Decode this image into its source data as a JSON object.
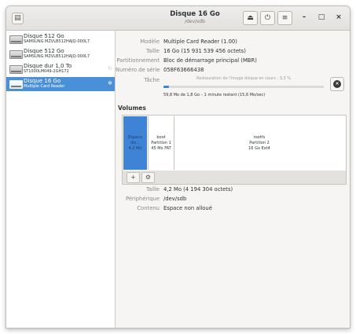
{
  "header": {
    "title": "Disque 16 Go",
    "subtitle": "/dev/sdb",
    "icons": [
      "eject-icon",
      "power-icon",
      "menu-icon",
      "minimize-icon",
      "maximize-icon",
      "close-icon"
    ],
    "left_icon": "sidebar-toggle-icon"
  },
  "sidebar": {
    "items": [
      {
        "name": "Disque 512 Go",
        "model": "SAMSUNG MZVLB512HAJQ-000L7",
        "busy": false
      },
      {
        "name": "Disque 512 Go",
        "model": "SAMSUNG MZVLB512HAJQ-000L7",
        "busy": false
      },
      {
        "name": "Disque dur 1,0 To",
        "model": "ST1000LM049-2GH172",
        "busy": true
      },
      {
        "name": "Disque 16 Go",
        "model": "Multiple Card  Reader",
        "busy": true
      }
    ]
  },
  "details": {
    "model_label": "Modèle",
    "model_value": "Multiple Card  Reader (1.00)",
    "size_label": "Taille",
    "size_value": "16 Go (15 931 539 456 octets)",
    "partitioning_label": "Partitionnement",
    "partitioning_value": "Bloc de démarrage principal (MBR)",
    "serial_label": "Numéro de série",
    "serial_value": "058F63666438",
    "task_label": "Tâche",
    "task_text": "Restauration de l'image disque en cours : 3,3 %",
    "task_progress": 0.033,
    "task_detail": "59,8 Mo de 1,8 Go – 1 minute restant (15,6 Mo/sec)",
    "cancel_icon": "cancel-icon"
  },
  "volumes": {
    "heading": "Volumes",
    "segments": [
      {
        "line1": "Espace dis...",
        "line2": "4,2 Mo",
        "line3": ""
      },
      {
        "line1": "boot",
        "line2": "Partition 1",
        "line3": "45 Mo FAT"
      },
      {
        "line1": "rootfs",
        "line2": "Partition 2",
        "line3": "16 Go Ext4"
      }
    ],
    "toolbar": {
      "add_label": "+",
      "settings_icon": "gears-icon"
    },
    "size_label": "Taille",
    "size_value": "4,2 Mo (4 194 304 octets)",
    "device_label": "Périphérique",
    "device_value": "/dev/sdb",
    "contents_label": "Contenu",
    "contents_value": "Espace non alloué"
  },
  "colors": {
    "accent": "#3584e4",
    "selection": "#4a90d9",
    "free_space": "#3f83d6"
  }
}
